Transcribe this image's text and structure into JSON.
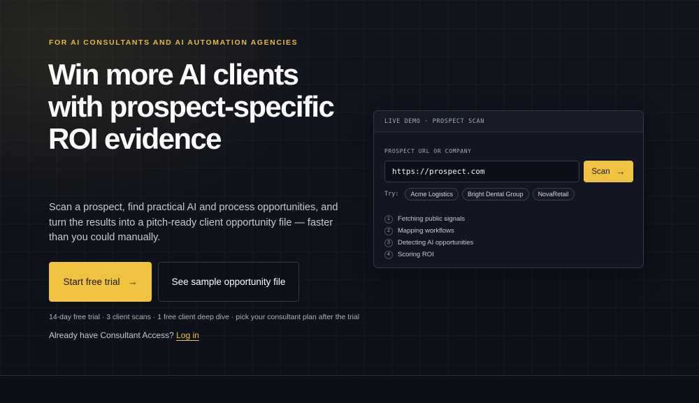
{
  "hero": {
    "eyebrow": "FOR AI CONSULTANTS AND AI AUTOMATION AGENCIES",
    "headline": "Win more AI clients with prospect-specific ROI evidence",
    "subhead": "Scan a prospect, find practical AI and process opportunities, and turn the results into a pitch-ready client opportunity file — faster than you could manually.",
    "primary_cta": "Start free trial",
    "secondary_cta": "See sample opportunity file",
    "fineprint": "14-day free trial · 3 client scans · 1 free client deep dive · pick your consultant plan after the trial",
    "login_prompt": "Already have Consultant Access?",
    "login_link": "Log in"
  },
  "demo": {
    "header": "LIVE DEMO · PROSPECT SCAN",
    "field_label": "PROSPECT URL OR COMPANY",
    "input_value": "https://prospect.com",
    "scan_label": "Scan",
    "try_label": "Try:",
    "examples": [
      "Acme Logistics",
      "Bright Dental Group",
      "NovaRetail"
    ],
    "steps": [
      {
        "num": "1",
        "label": "Fetching public signals"
      },
      {
        "num": "2",
        "label": "Mapping workflows"
      },
      {
        "num": "3",
        "label": "Detecting AI opportunities"
      },
      {
        "num": "4",
        "label": "Scoring ROI"
      }
    ]
  },
  "icons": {
    "arrow": "→"
  },
  "colors": {
    "accent": "#efc33f",
    "background": "#0f121b"
  }
}
